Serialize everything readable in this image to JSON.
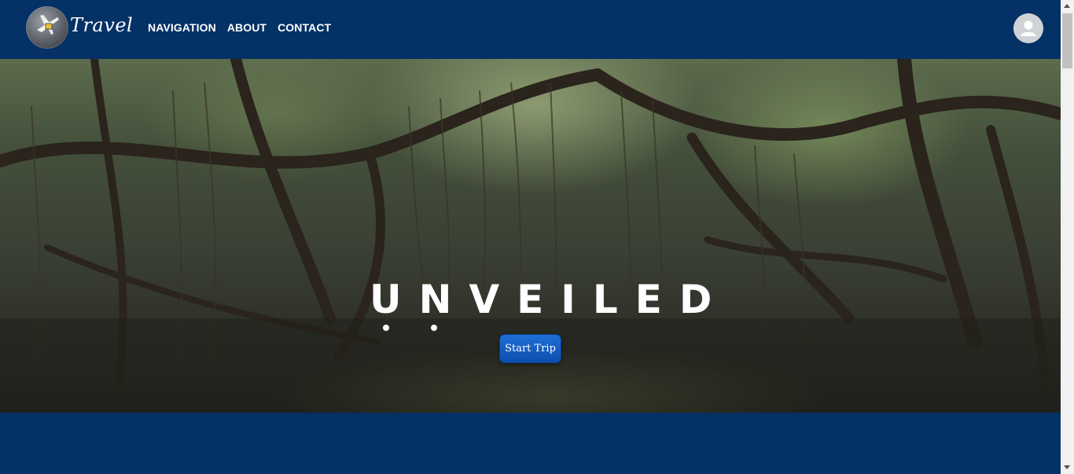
{
  "header": {
    "logo_text": "Travel",
    "nav": [
      "NAVIGATION",
      "ABOUT",
      "CONTACT"
    ],
    "avatar_icon": "user-avatar-icon"
  },
  "hero": {
    "title": "UNVEILED",
    "button_label": "Start Trip"
  },
  "colors": {
    "header_bg": "#043166",
    "button_bg": "#0b4fae"
  }
}
